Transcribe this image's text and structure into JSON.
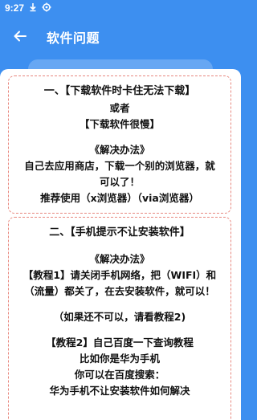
{
  "status_bar": {
    "time": "9:27",
    "icons": [
      "download-icon",
      "settings-gear-icon"
    ]
  },
  "app_bar": {
    "back_icon": "back-arrow-icon",
    "title": "软件问题"
  },
  "colors": {
    "primary": "#3d8ff0",
    "card_border": "#e8877e",
    "text": "#111111"
  },
  "cards": [
    {
      "lines": {
        "title": "一、【下载软件时卡住无法下载】",
        "or": "或者",
        "subtitle": "【下载软件很慢】",
        "solution_label": "《解决办法》",
        "solution_1": "自己去应用商店，下载一个别的浏览器，就",
        "solution_2": "可以了！",
        "recommend": "推荐使用（x浏览器）（via浏览器）"
      }
    },
    {
      "lines": {
        "title": "二、【手机提示不让安装软件】",
        "solution_label": "《解决办法》",
        "tutorial1_1": "【教程1】请关闭手机网络，把（WIFI）和",
        "tutorial1_2": "（流量）都关了，在去安装软件，就可以！",
        "fallback": "（如果还不可以，请看教程2)",
        "tutorial2_1": "【教程2】自己百度一下查询教程",
        "tutorial2_2": "比如你是华为手机",
        "tutorial2_3": "你可以在百度搜索：",
        "tutorial2_4": "华为手机不让安装软件如何解决"
      }
    }
  ]
}
